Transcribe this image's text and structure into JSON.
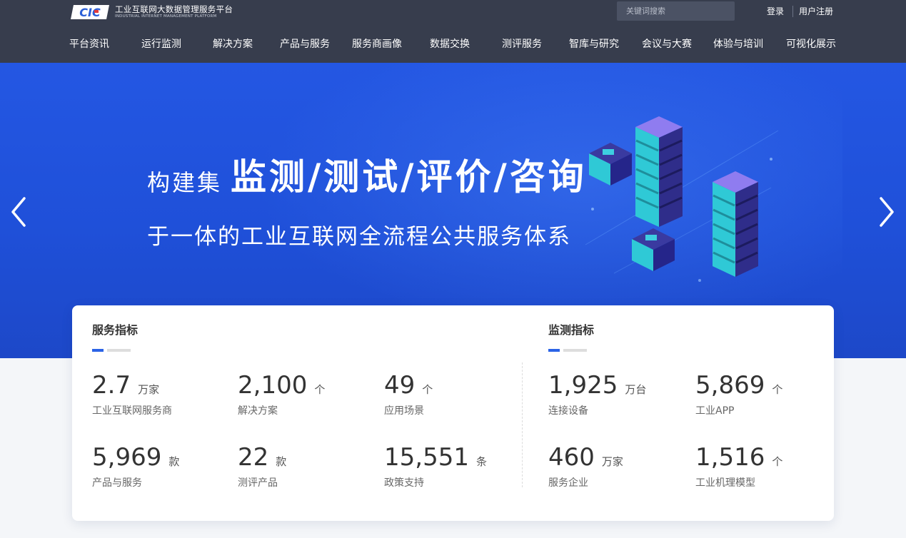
{
  "header": {
    "logo": {
      "mark_text": "CIC",
      "title": "工业互联网大数据管理服务平台",
      "subtitle": "INDUSTRIAL INTERNET MANAGEMENT PLATFORM"
    },
    "search": {
      "placeholder": "关键词搜索",
      "value": ""
    },
    "login_label": "登录",
    "register_label": "用户注册",
    "nav": [
      "平台资讯",
      "运行监测",
      "解决方案",
      "产品与服务",
      "服务商画像",
      "数据交换",
      "测评服务",
      "智库与研究",
      "会议与大赛",
      "体验与培训",
      "可视化展示"
    ]
  },
  "banner": {
    "headline_prefix": "构建集",
    "headline_main": "监测/测试/评价/咨询",
    "subline": "于一体的工业互联网全流程公共服务体系"
  },
  "stats": {
    "service": {
      "title": "服务指标",
      "items": [
        {
          "value": "2.7",
          "unit": "万家",
          "label": "工业互联网服务商"
        },
        {
          "value": "2,100",
          "unit": "个",
          "label": "解决方案"
        },
        {
          "value": "49",
          "unit": "个",
          "label": "应用场景"
        },
        {
          "value": "5,969",
          "unit": "款",
          "label": "产品与服务"
        },
        {
          "value": "22",
          "unit": "款",
          "label": "测评产品"
        },
        {
          "value": "15,551",
          "unit": "条",
          "label": "政策支持"
        }
      ]
    },
    "monitor": {
      "title": "监测指标",
      "items": [
        {
          "value": "1,925",
          "unit": "万台",
          "label": "连接设备"
        },
        {
          "value": "5,869",
          "unit": "个",
          "label": "工业APP"
        },
        {
          "value": "460",
          "unit": "万家",
          "label": "服务企业"
        },
        {
          "value": "1,516",
          "unit": "个",
          "label": "工业机理模型"
        }
      ]
    }
  },
  "colors": {
    "header_bg": "#373d4d",
    "banner_blue": "#2457e3",
    "accent": "#2b63e6",
    "cyan": "#3ee0e8"
  },
  "icons": [
    "cic-logo",
    "search-icon",
    "chevron-left-icon",
    "chevron-right-icon",
    "server-illustration"
  ]
}
